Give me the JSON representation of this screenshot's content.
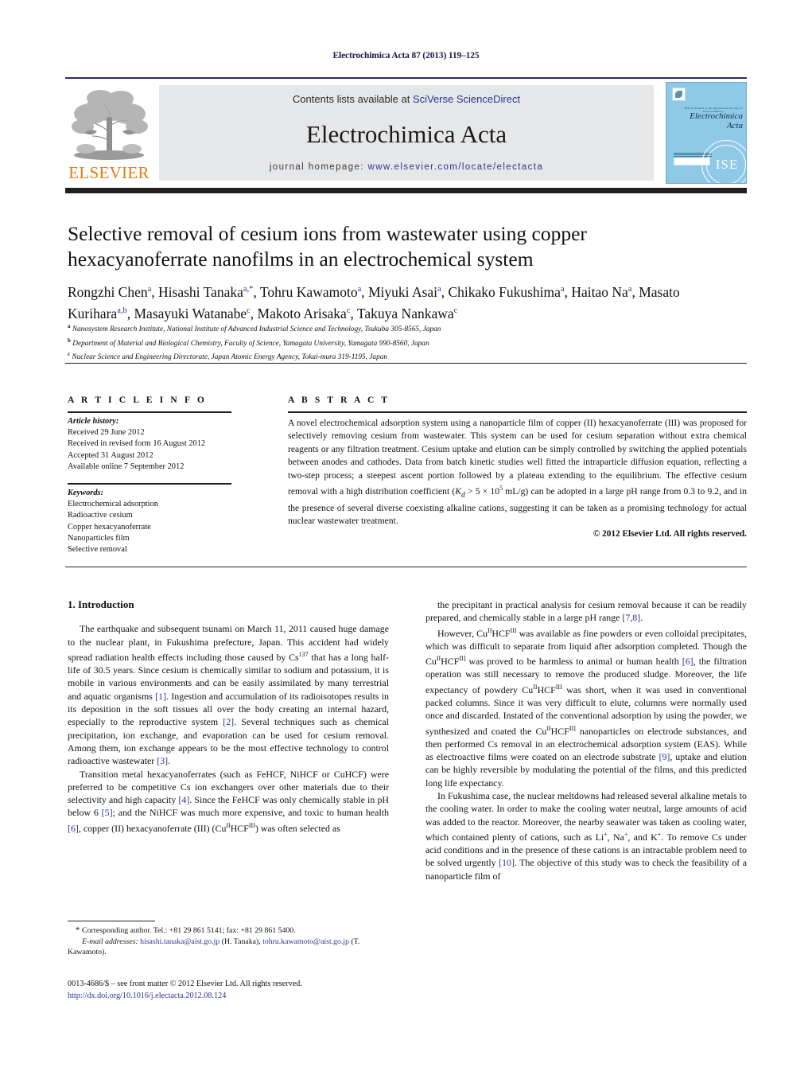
{
  "running_head": "Electrochimica Acta 87 (2013) 119–125",
  "header": {
    "publisher_logo_label": "ELSEVIER",
    "contents_prefix": "Contents lists available at ",
    "contents_link": "SciVerse ScienceDirect",
    "journal_name": "Electrochimica Acta",
    "homepage_prefix": "journal homepage: ",
    "homepage_url": "www.elsevier.com/locate/electacta",
    "cover": {
      "society_line": "Official Journal of the International Society of Electrochemistry",
      "title_line_1": "Electrochimica",
      "title_line_2": "Acta",
      "badge_text": "ISE"
    },
    "accent_orange": "#e87b10",
    "link_blue": "#2e3192",
    "band_gray": "#e6e7e9",
    "cover_blue": "#8ecae8"
  },
  "article": {
    "title": "Selective removal of cesium ions from wastewater using copper hexacyanoferrate nanofilms in an electrochemical system",
    "authors_html": "Rongzhi Chen<sup>a</sup>, Hisashi Tanaka<sup>a,*</sup>, Tohru Kawamoto<sup>a</sup>, Miyuki Asai<sup>a</sup>, Chikako Fukushima<sup>a</sup>, Haitao Na<sup>a</sup>, Masato Kurihara<sup>a,b</sup>, Masayuki Watanabe<sup>c</sup>, Makoto Arisaka<sup>c</sup>, Takuya Nankawa<sup>c</sup>",
    "affiliations": [
      {
        "marker": "a",
        "text": "Nanosystem Research Institute, National Institute of Advanced Industrial Science and Technology, Tsukuba 305-8565, Japan"
      },
      {
        "marker": "b",
        "text": "Department of Material and Biological Chemistry, Faculty of Science, Yamagata University, Yamagata 990-8560, Japan"
      },
      {
        "marker": "c",
        "text": "Nuclear Science and Engineering Directorate, Japan Atomic Energy Agency, Tokai-mura 319-1195, Japan"
      }
    ]
  },
  "article_info": {
    "heading": "A R T I C L E   I N F O",
    "history_label": "Article history:",
    "history": [
      "Received 29 June 2012",
      "Received in revised form 16 August 2012",
      "Accepted 31 August 2012",
      "Available online 7 September 2012"
    ],
    "keywords_label": "Keywords:",
    "keywords": [
      "Electrochemical adsorption",
      "Radioactive cesium",
      "Copper hexacyanoferrate",
      "Nanoparticles film",
      "Selective removal"
    ]
  },
  "abstract": {
    "heading": "A B S T R A C T",
    "text_html": "A novel electrochemical adsorption system using a nanoparticle film of copper (II) hexacyanoferrate (III) was proposed for selectively removing cesium from wastewater. This system can be used for cesium separation without extra chemical reagents or any filtration treatment. Cesium uptake and elution can be simply controlled by switching the applied potentials between anodes and cathodes. Data from batch kinetic studies well fitted the intraparticle diffusion equation, reflecting a two-step process; a steepest ascent portion followed by a plateau extending to the equilibrium. The effective cesium removal with a high distribution coefficient (<span class=\"it\">K<sub>d</sub></span> &gt; 5 × 10<sup>5</sup> mL/g) can be adopted in a large pH range from 0.3 to 9.2, and in the presence of several diverse coexisting alkaline cations, suggesting it can be taken as a promising technology for actual nuclear wastewater treatment.",
    "copyright": "© 2012 Elsevier Ltd. All rights reserved."
  },
  "body": {
    "section_number_title": "1.  Introduction",
    "left_paragraphs_html": [
      "The earthquake and subsequent tsunami on March 11, 2011 caused huge damage to the nuclear plant, in Fukushima prefecture, Japan. This accident had widely spread radiation health effects including those caused by Cs<sup>137</sup> that has a long half-life of 30.5 years. Since cesium is chemically similar to sodium and potassium, it is mobile in various environments and can be easily assimilated by many terrestrial and aquatic organisms <span class=\"ref\">[1]</span>. Ingestion and accumulation of its radioisotopes results in its deposition in the soft tissues all over the body creating an internal hazard, especially to the reproductive system <span class=\"ref\">[2]</span>. Several techniques such as chemical precipitation, ion exchange, and evaporation can be used for cesium removal. Among them, ion exchange appears to be the most effective technology to control radioactive wastewater <span class=\"ref\">[3]</span>.",
      "Transition metal hexacyanoferrates (such as FeHCF, NiHCF or CuHCF) were preferred to be competitive Cs ion exchangers over other materials due to their selectivity and high capacity <span class=\"ref\">[4]</span>. Since the FeHCF was only chemically stable in pH below 6 <span class=\"ref\">[5]</span>; and the NiHCF was much more expensive, and toxic to human health <span class=\"ref\">[6]</span>, copper (II) hexacyanoferrate (III) (Cu<sup>II</sup>HCF<sup>III</sup>) was often selected as"
    ],
    "right_paragraphs_html": [
      "the precipitant in practical analysis for cesium removal because it can be readily prepared, and chemically stable in a large pH range <span class=\"ref\">[7,8]</span>.",
      "However, Cu<sup>II</sup>HCF<sup>III</sup> was available as fine powders or even colloidal precipitates, which was difficult to separate from liquid after adsorption completed. Though the Cu<sup>II</sup>HCF<sup>II]</sup> was proved to be harmless to animal or human health <span class=\"ref\">[6]</span>, the filtration operation was still necessary to remove the produced sludge. Moreover, the life expectancy of powdery Cu<sup>II</sup>HCF<sup>III</sup> was short, when it was used in conventional packed columns. Since it was very difficult to elute, columns were normally used once and discarded. Instated of the conventional adsorption by using the powder, we synthesized and coated the Cu<sup>II</sup>HCF<sup>II]</sup> nanoparticles on electrode substances, and then performed Cs removal in an electrochemical adsorption system (EAS). While as electroactive films were coated on an electrode substrate <span class=\"ref\">[9]</span>, uptake and elution can be highly reversible by modulating the potential of the films, and this predicted long life expectancy.",
      "In Fukushima case, the nuclear meltdowns had released several alkaline metals to the cooling water. In order to make the cooling water neutral, large amounts of acid was added to the reactor. Moreover, the nearby seawater was taken as cooling water, which contained plenty of cations, such as Li<sup>+</sup>, Na<sup>+</sup>, and K<sup>+</sup>. To remove Cs under acid conditions and in the presence of these cations is an intractable problem need to be solved urgently <span class=\"ref\">[10]</span>. The objective of this study was to check the feasibility of a nanoparticle film of"
    ]
  },
  "footnote": {
    "corresponding_html": "<span style=\"font-size:11px\">*</span> Corresponding author. Tel.: +81 29 861 5141; fax: +81 29 861 5400.",
    "email_label": "E-mail addresses:",
    "emails": [
      {
        "address": "hisashi.tanaka@aist.go.jp",
        "person": "(H. Tanaka)"
      },
      {
        "address": "tohru.kawamoto@aist.go.jp",
        "person": "(T. Kawamoto)"
      }
    ]
  },
  "frontmatter": {
    "issn_line": "0013-4686/$ – see front matter © 2012 Elsevier Ltd. All rights reserved.",
    "doi": "http://dx.doi.org/10.1016/j.electacta.2012.08.124"
  }
}
